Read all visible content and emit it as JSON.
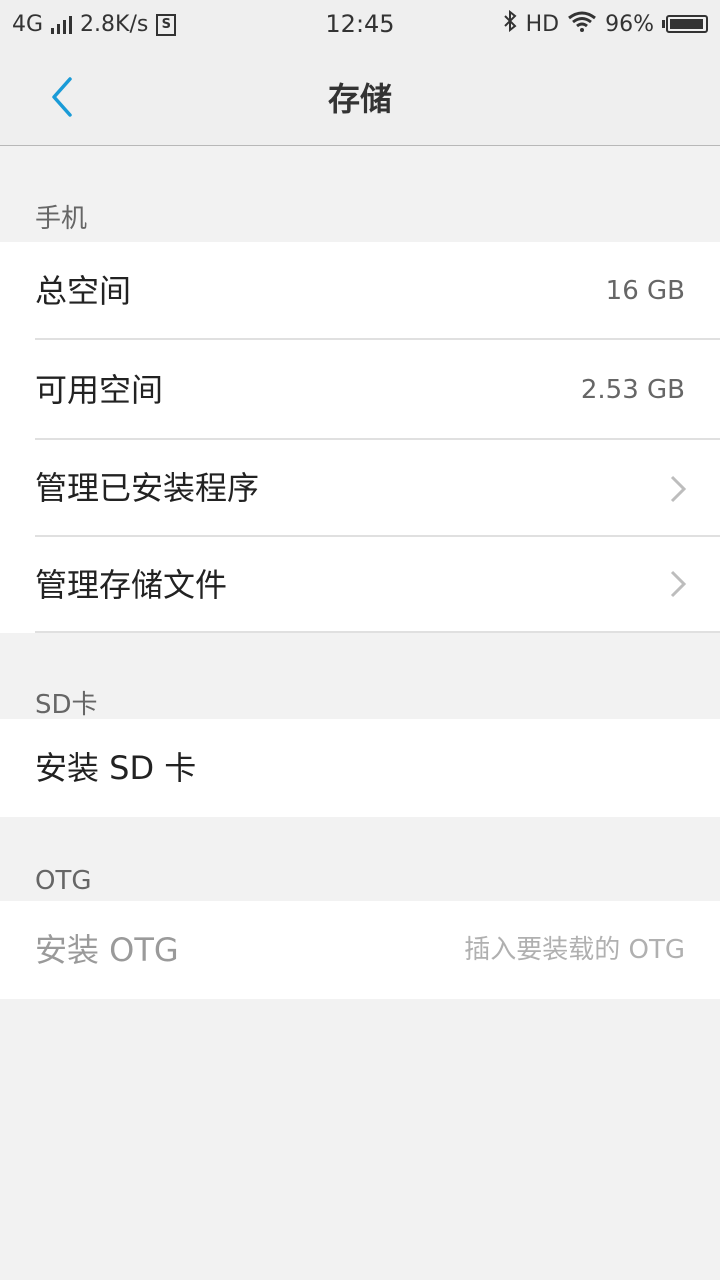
{
  "status_bar": {
    "network": "4G",
    "speed": "2.8K/s",
    "time": "12:45",
    "hd": "HD",
    "battery": "96%",
    "battery_level": 0.96
  },
  "header": {
    "title": "存储"
  },
  "sections": {
    "phone": {
      "title": "手机",
      "total_label": "总空间",
      "total_value": "16 GB",
      "available_label": "可用空间",
      "available_value": "2.53 GB",
      "manage_apps_label": "管理已安装程序",
      "manage_files_label": "管理存储文件"
    },
    "sd": {
      "title": "SD卡",
      "install_label": "安装 SD 卡"
    },
    "otg": {
      "title": "OTG",
      "install_label": "安装 OTG",
      "install_hint": "插入要装载的 OTG"
    }
  },
  "colors": {
    "accent": "#1a9bd7",
    "background": "#f2f2f2",
    "card": "#ffffff"
  }
}
